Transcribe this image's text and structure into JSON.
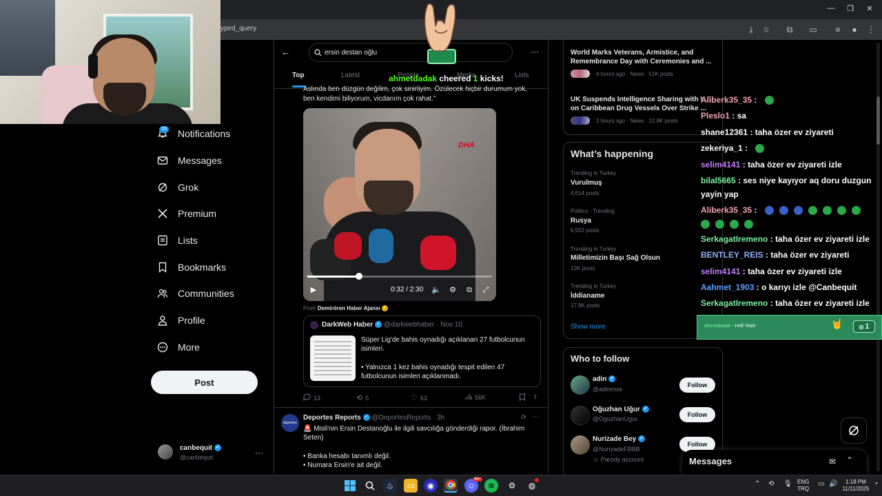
{
  "browser": {
    "url_fragment": "yped_query",
    "window_controls": [
      "—",
      "❐",
      "✕"
    ]
  },
  "nav": {
    "notifications_badge": "15",
    "items": [
      {
        "label": "Notifications",
        "icon": "bell-icon"
      },
      {
        "label": "Messages",
        "icon": "envelope-icon"
      },
      {
        "label": "Grok",
        "icon": "grok-icon"
      },
      {
        "label": "Premium",
        "icon": "x-logo-icon"
      },
      {
        "label": "Lists",
        "icon": "list-icon"
      },
      {
        "label": "Bookmarks",
        "icon": "bookmark-icon"
      },
      {
        "label": "Communities",
        "icon": "people-icon"
      },
      {
        "label": "Profile",
        "icon": "person-icon"
      },
      {
        "label": "More",
        "icon": "more-circle-icon"
      }
    ],
    "post_label": "Post",
    "account": {
      "name": "canbequit",
      "handle": "@canbequit"
    }
  },
  "search": {
    "query": "ersin destan oğlu",
    "tabs": [
      "Top",
      "Latest",
      "People",
      "Media",
      "Lists"
    ],
    "active_tab": "Top"
  },
  "tweet1": {
    "text_line1": "Aslında ben düzgün değilim, çok sinirliyim. Özülecek hiçbir durumum yok,",
    "text_line2": "ben kendimi biliyorum, vicdanım çok rahat.\"",
    "video": {
      "watermark": "DHA",
      "time": "0:32 / 2:30",
      "progress": 0.28
    },
    "from_prefix": "From",
    "from_source": "Demirören Haber Ajansı",
    "quote": {
      "name": "DarkWeb Haber",
      "handle": "@darkwebhaber",
      "date": "· Nov 10",
      "text1": "Süper Lig'de bahis oynadığı açıklanan 27 futbolcunun isimleri.",
      "text2": "• Yalnızca 1 kez bahis oynadığı tespit edilen 47 futbolcunun isimleri açıklanmadı."
    },
    "actions": {
      "replies": "13",
      "reposts": "5",
      "likes": "63",
      "views": "56K"
    }
  },
  "tweet2": {
    "author": "Deportes Reports",
    "handle": "@DeportesReports",
    "time": "· 3h",
    "avatar_text": "deportes",
    "line1": "🚨 Misli'nin Ersin Destanoğlu ile ilgili savcılığa gönderdiği rapor. (İbrahim",
    "line2": "Seten)",
    "line3": "• Banka hesabı tanımlı değil.",
    "line4": "• Numara Ersin'e ait değil."
  },
  "news": [
    {
      "title": "World Marks Veterans, Armistice, and Remembrance Day with Ceremonies and ...",
      "meta": "4 hours ago · News · 51K posts"
    },
    {
      "title": "UK Suspends Intelligence Sharing with U.S. on Caribbean Drug Vessels Over Strike ...",
      "meta": "2 hours ago · News · 12.8K posts"
    }
  ],
  "happening": {
    "title": "What’s happening",
    "trends": [
      {
        "context": "Trending in Turkey",
        "name": "Vurulmuş",
        "posts": "4,614 posts"
      },
      {
        "context": "Politics · Trending",
        "name": "Rusya",
        "posts": "6,552 posts"
      },
      {
        "context": "Trending in Turkey",
        "name": "Milletimizin Başı Sağ Olsun",
        "posts": "12K posts"
      },
      {
        "context": "Trending in Turkey",
        "name": "İddianame",
        "posts": "17.8K posts"
      }
    ],
    "show_more": "Show more"
  },
  "who_to_follow": {
    "title": "Who to follow",
    "users": [
      {
        "name": "adin",
        "handle": "@adinross",
        "extra": "",
        "button": "Follow"
      },
      {
        "name": "Oğuzhan Uğur",
        "handle": "@OguzhanUgur",
        "extra": "",
        "button": "Follow"
      },
      {
        "name": "Nurizade Bey",
        "handle": "@NurizadeFBBB",
        "extra": "Parody account",
        "button": "Follow"
      }
    ]
  },
  "chat": [
    {
      "user": "Aliberk35_35",
      "msg": "",
      "color": "#f0a3b8",
      "emotes": 1
    },
    {
      "user": "Pleslo1",
      "msg": "sa",
      "color": "#f0a3b8",
      "emotes": 0
    },
    {
      "user": "shane12361",
      "msg": "taha özer ev ziyareti",
      "color": "#ffffff",
      "emotes": 0
    },
    {
      "user": "zekeriya_1",
      "msg": "",
      "color": "#ffffff",
      "emotes": 1
    },
    {
      "user": "selim4141",
      "msg": "taha özer ev ziyareti izle",
      "color": "#c77dff",
      "emotes": 0
    },
    {
      "user": "bilal5665",
      "msg": "ses niye kayıyor aq doru duzgun",
      "color": "#7cf0a0",
      "emotes": 0
    },
    {
      "user": "",
      "msg": "yayin yap",
      "color": "#ffffff",
      "emotes": 0
    },
    {
      "user": "Aliberk35_35",
      "msg": "",
      "color": "#f0a3b8",
      "emotes": 7
    },
    {
      "user": "",
      "msg": "",
      "color": "#ffffff",
      "emotes": 4
    },
    {
      "user": "SerkagatIremeno",
      "msg": "taha özer ev ziyareti izle",
      "color": "#7cf0a0",
      "emotes": 0
    },
    {
      "user": "BENTLEY_REIS",
      "msg": "taha özer ev ziyareti",
      "color": "#8fb3ff",
      "emotes": 0
    },
    {
      "user": "selim4141",
      "msg": "taha özer ev ziyareti izle",
      "color": "#c77dff",
      "emotes": 0
    },
    {
      "user": "Aahmet_1903",
      "msg": "o karıyı izle @Canbequit",
      "color": "#5aa0ff",
      "emotes": 0
    },
    {
      "user": "SerkagatIremeno",
      "msg": "taha özer ev ziyareti izle",
      "color": "#7cf0a0",
      "emotes": 0
    }
  ],
  "cheer": {
    "user": "ahmetdadak",
    "message": "Hell Yeah",
    "count": "1",
    "alert_user": "ahmetdadak",
    "alert_mid": "cheered",
    "alert_num": "1",
    "alert_end": "kicks!"
  },
  "messages_drawer": {
    "title": "Messages"
  },
  "taskbar": {
    "lang_top": "ENG",
    "lang_bottom": "TRQ",
    "time": "1:18 PM",
    "date": "11/11/2025",
    "discord_badge": "99+"
  }
}
